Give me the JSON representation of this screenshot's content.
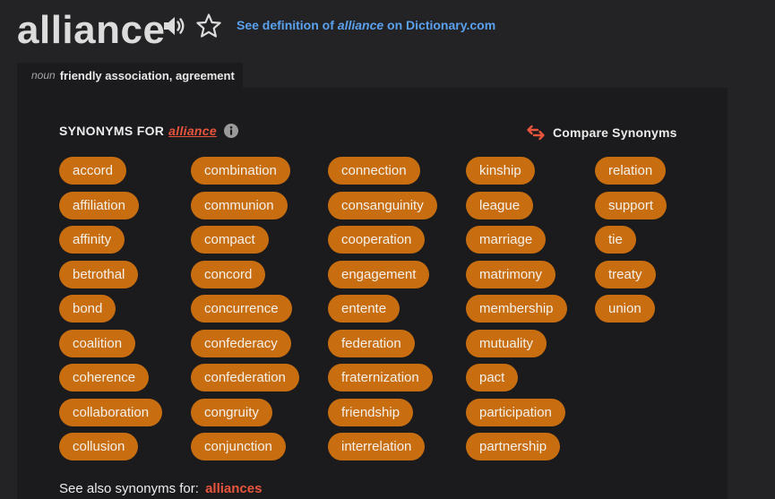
{
  "header": {
    "word": "alliance",
    "link_prefix": "See definition of ",
    "link_word": "alliance",
    "link_suffix": " on Dictionary.com"
  },
  "definition": {
    "part_of_speech": "noun",
    "text": "friendly association, agreement"
  },
  "synonyms": {
    "heading_prefix": "SYNONYMS FOR",
    "heading_word": "alliance",
    "compare_label": "Compare Synonyms",
    "columns": [
      [
        "accord",
        "affiliation",
        "affinity",
        "betrothal",
        "bond",
        "coalition",
        "coherence",
        "collaboration",
        "collusion"
      ],
      [
        "combination",
        "communion",
        "compact",
        "concord",
        "concurrence",
        "confederacy",
        "confederation",
        "congruity",
        "conjunction"
      ],
      [
        "connection",
        "consanguinity",
        "cooperation",
        "engagement",
        "entente",
        "federation",
        "fraternization",
        "friendship",
        "interrelation"
      ],
      [
        "kinship",
        "league",
        "marriage",
        "matrimony",
        "membership",
        "mutuality",
        "pact",
        "participation",
        "partnership"
      ],
      [
        "relation",
        "support",
        "tie",
        "treaty",
        "union"
      ]
    ]
  },
  "see_also": {
    "prefix": "See also synonyms for:",
    "word": "alliances"
  },
  "colors": {
    "background": "#232325",
    "panel": "#1b1b1d",
    "pill": "#c86e10",
    "link_blue": "#5aa2f0",
    "highlight_red": "#e8553d"
  },
  "icons": [
    "speaker-icon",
    "star-icon",
    "info-icon",
    "compare-arrows-icon"
  ]
}
